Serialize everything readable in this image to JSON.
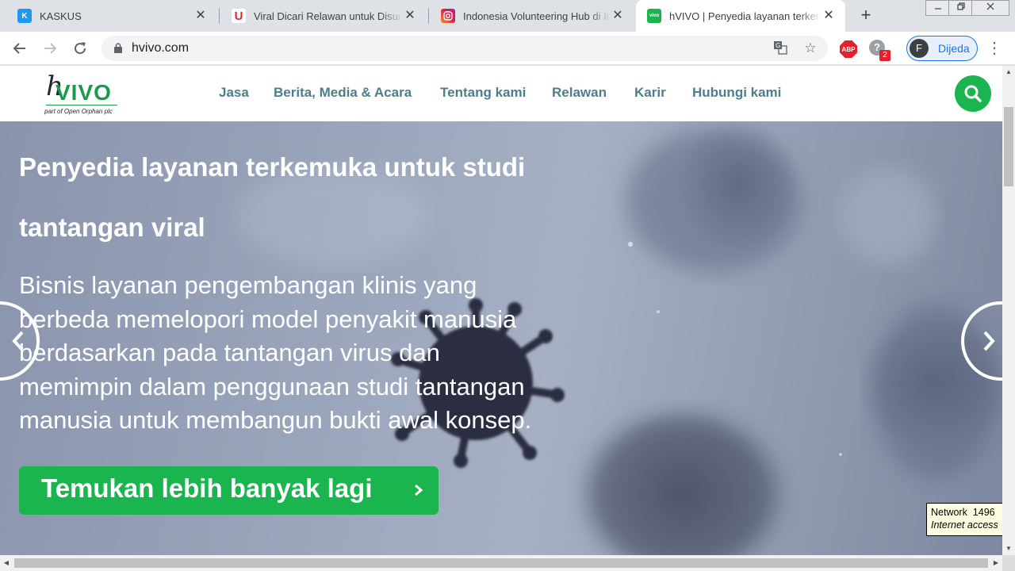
{
  "browser": {
    "tabs": [
      {
        "title": "KASKUS",
        "favicon": "kaskus-favicon",
        "favicon_color": "#1c98f5",
        "favicon_text": "K",
        "active": false
      },
      {
        "title": "Viral Dicari Relawan untuk Disuntik",
        "favicon": "magnet-favicon",
        "favicon_color": "#ffffff",
        "favicon_text": "U",
        "active": false
      },
      {
        "title": "Indonesia Volunteering Hub di Instagram",
        "favicon": "instagram-favicon",
        "favicon_color": "#d6249f",
        "favicon_text": "",
        "active": false
      },
      {
        "title": "hVIVO | Penyedia layanan terkemuka",
        "favicon": "hvivo-favicon",
        "favicon_color": "#1ab54f",
        "favicon_text": "vivo",
        "active": true
      }
    ],
    "new_tab_glyph": "+",
    "close_glyph": "✕",
    "url": "hvivo.com",
    "profile_initial": "F",
    "profile_name": "Dijeda",
    "abp_label": "ABP",
    "ext_badge": "2"
  },
  "site": {
    "logo": {
      "h": "h",
      "brand": "VIVO",
      "tagline": "part of Open Orphan plc"
    },
    "nav": [
      "Jasa",
      "Berita, Media & Acara",
      "Tentang kami",
      "Relawan",
      "Karir",
      "Hubungi kami"
    ],
    "hero": {
      "title": "Penyedia layanan terkemuka untuk studi tantangan viral",
      "body": "Bisnis layanan pengembangan klinis yang berbeda memelopori model penyakit manusia berdasarkan pada tantangan virus dan memimpin dalam penggunaan studi tantangan manusia untuk membangun bukti awal konsep.",
      "cta": "Temukan lebih banyak lagi"
    },
    "colors": {
      "brand_green": "#1ab54f",
      "nav_text": "#4a7f8c"
    }
  },
  "status": {
    "line1": "Network  1496",
    "line2": "Internet access"
  }
}
